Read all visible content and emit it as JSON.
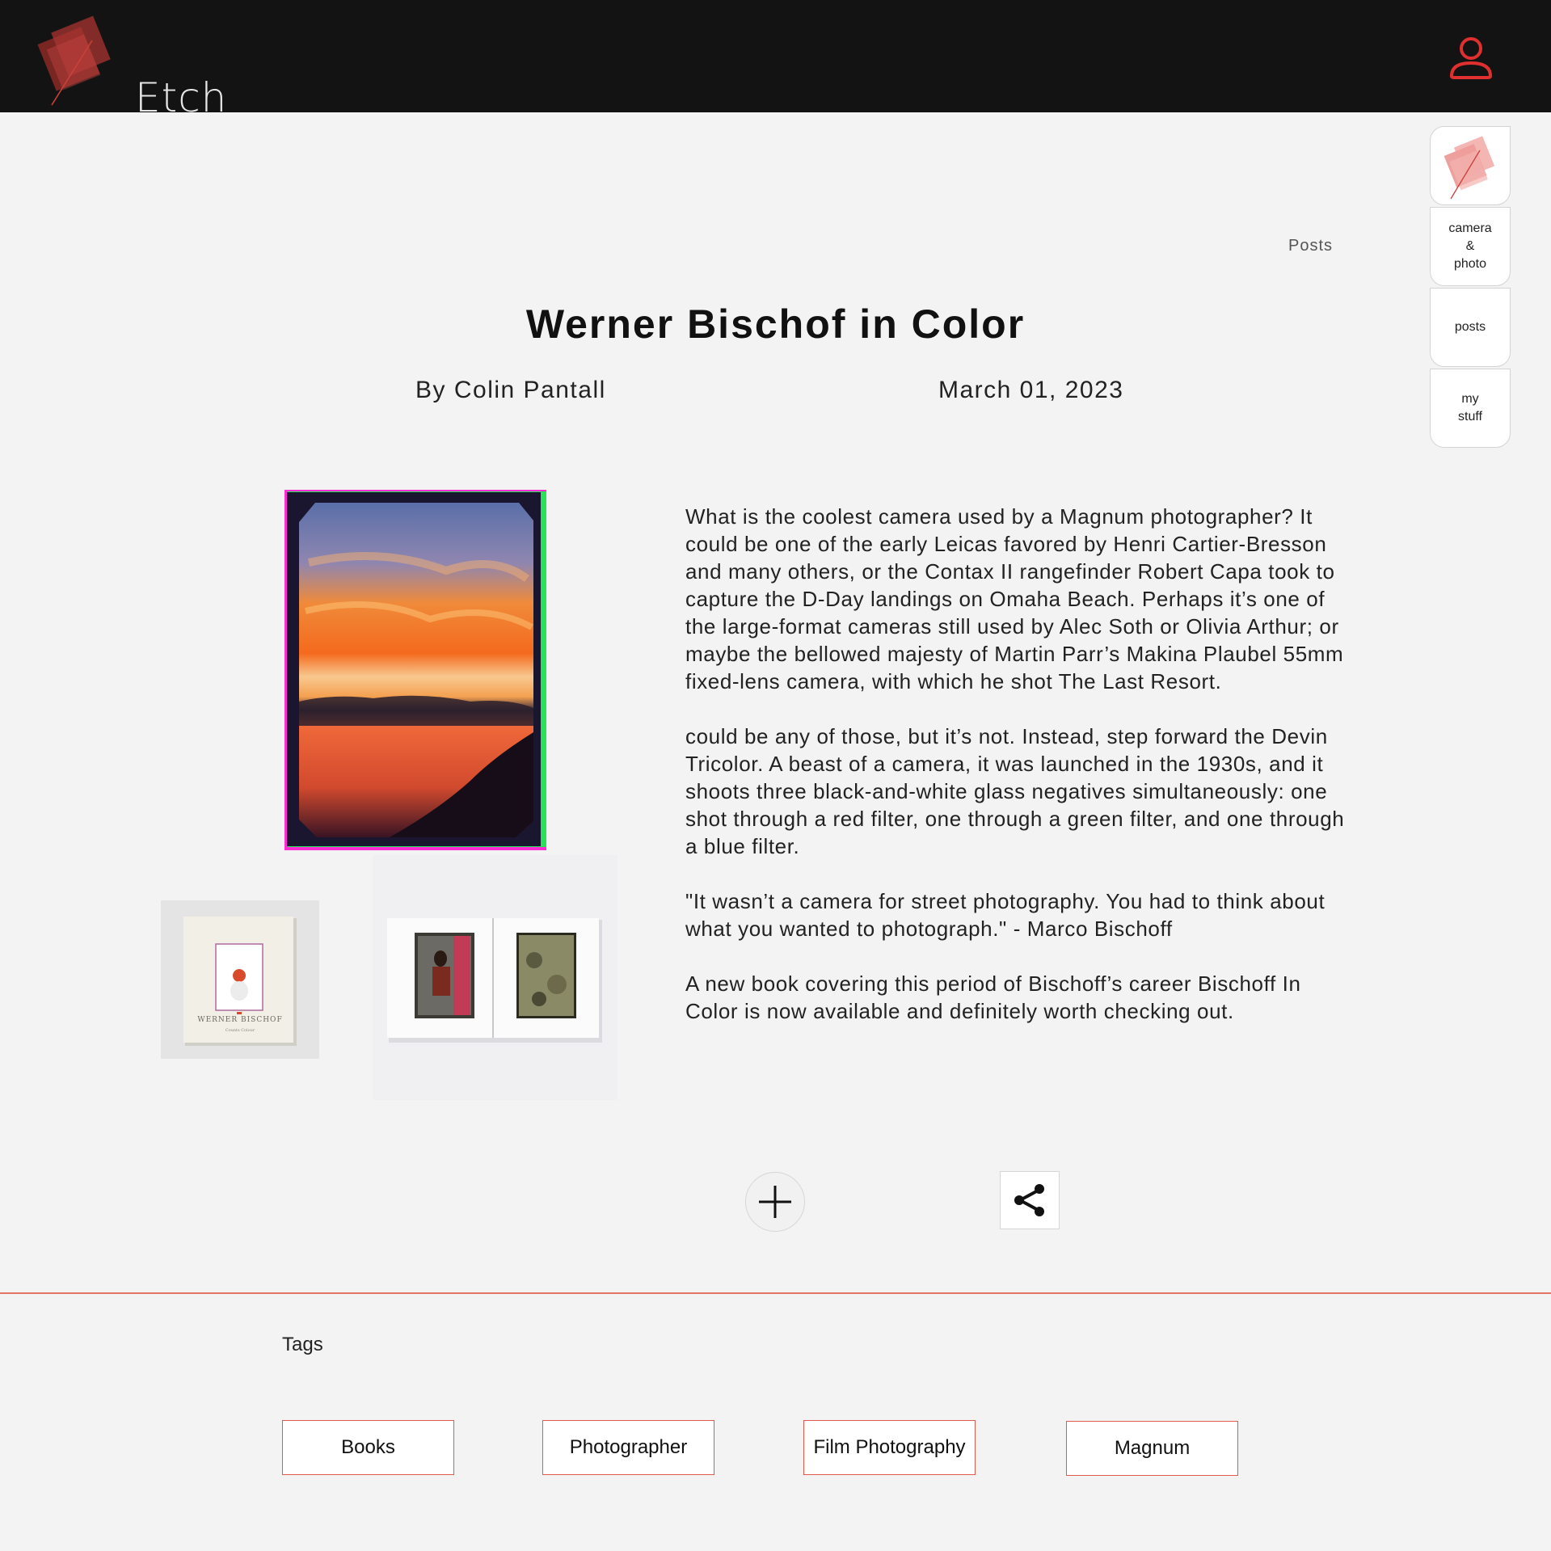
{
  "app": {
    "name": "Etch"
  },
  "side_nav": {
    "items": [
      {
        "label": "",
        "icon": "etch-logo-icon"
      },
      {
        "label": "camera\n&\nphoto"
      },
      {
        "label": "posts"
      },
      {
        "label": "my\nstuff"
      }
    ]
  },
  "breadcrumb": "Posts",
  "article": {
    "title": "Werner Bischof in Color",
    "author": "By Colin Pantall",
    "date": "March 01, 2023",
    "paragraphs": [
      "What is the coolest camera used by a Magnum photographer? It could be one of the early Leicas favored by Henri Cartier-Bresson and many others, or the Contax II rangefinder Robert Capa took to capture the D-Day landings on Omaha Beach. Perhaps it’s one of the large-format cameras still used by Alec Soth or Olivia Arthur; or maybe the bellowed majesty of Martin Parr’s Makina Plaubel 55mm fixed-lens camera, with which he shot The Last Resort.",
      "could be any of those, but it’s not. Instead, step forward the Devin Tricolor. A beast of a camera, it was launched in the 1930s, and it shoots three black-and-white glass negatives simultaneously: one shot through a red filter, one through a green filter, and one through a blue filter.",
      "\"It wasn’t a camera for street photography. You had to think about what you wanted to photograph.\" - Marco Bischoff",
      "A new book covering this period of Bischoff’s career Bischoff In Color is now available and definitely worth checking out."
    ],
    "book_cover_text": "WERNER BISCHOF",
    "book_cover_subtext": "Counts Colour"
  },
  "actions": {
    "add_icon": "plus-icon",
    "share_icon": "share-icon"
  },
  "tags": {
    "label": "Tags",
    "items": [
      "Books",
      "Photographer",
      "Film Photography",
      "Magnum"
    ]
  },
  "colors": {
    "accent": "#e02f2f",
    "topbar": "#131313",
    "tag_border": "#e05a4d",
    "divider": "#e07565"
  }
}
